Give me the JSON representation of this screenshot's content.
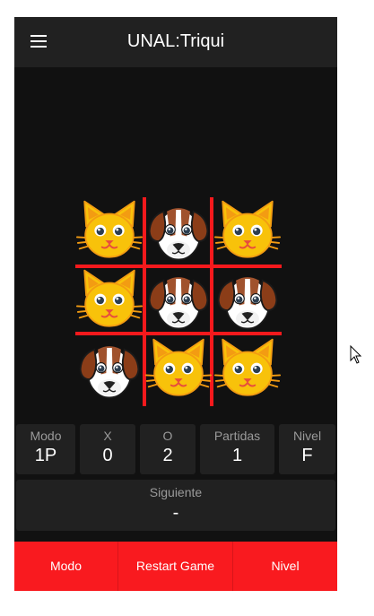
{
  "app": {
    "title": "UNAL:Triqui",
    "menu_icon": "hamburger-menu-icon"
  },
  "board": {
    "cells": [
      "cat",
      "dog",
      "cat",
      "cat",
      "dog",
      "dog",
      "dog",
      "cat",
      "cat"
    ],
    "grid_color": "#f5191c"
  },
  "stats": [
    {
      "label": "Modo",
      "value": "1P"
    },
    {
      "label": "X",
      "value": "0"
    },
    {
      "label": "O",
      "value": "2"
    },
    {
      "label": "Partidas",
      "value": "1"
    },
    {
      "label": "Nivel",
      "value": "F"
    }
  ],
  "next": {
    "label": "Siguiente",
    "value": "-"
  },
  "bottom_bar": {
    "mode_label": "Modo",
    "restart_label": "Restart Game",
    "level_label": "Nivel"
  },
  "colors": {
    "accent": "#f91a1f",
    "background": "#111111",
    "panel": "#212121"
  }
}
